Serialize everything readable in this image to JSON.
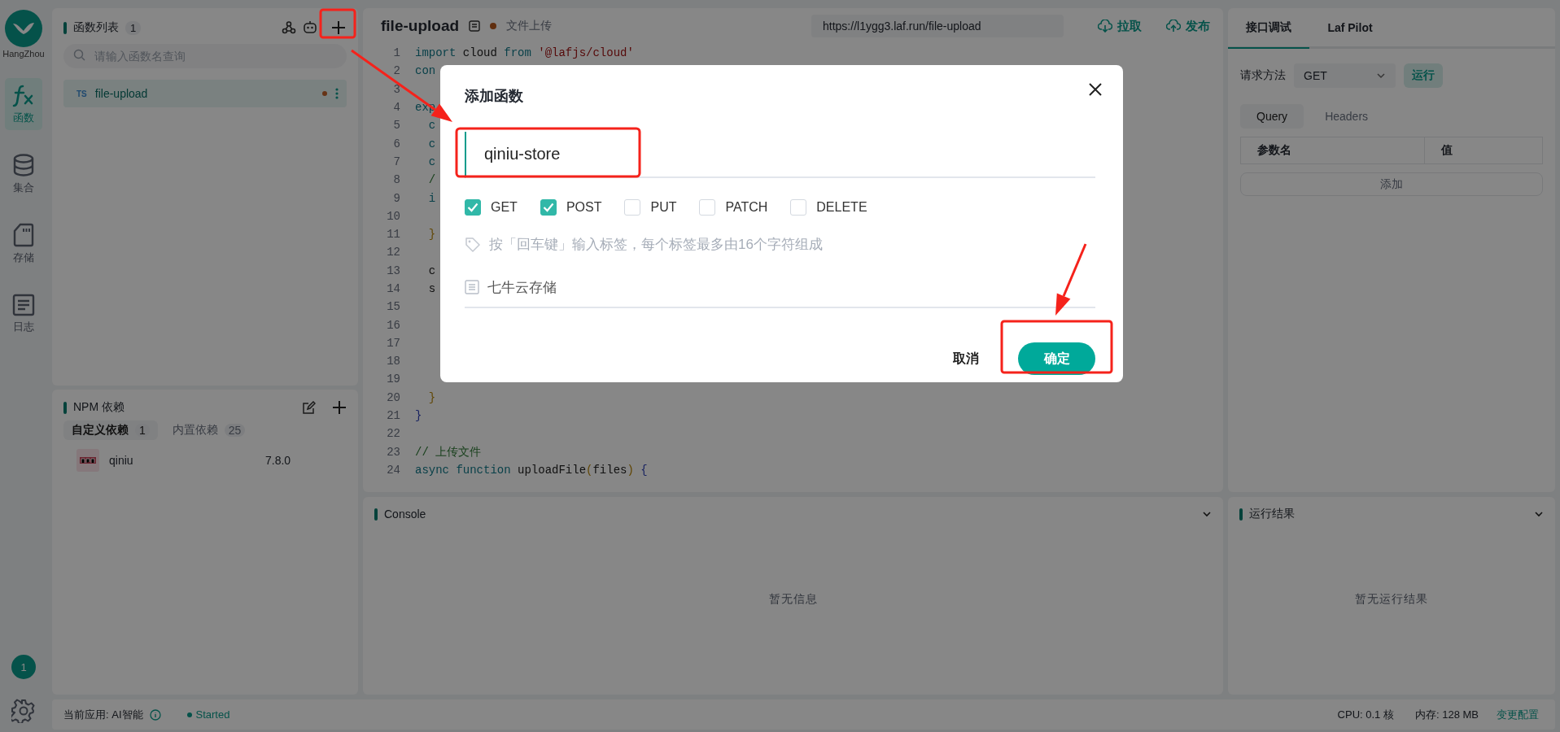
{
  "sidebar": {
    "logo_caption": "HangZhou",
    "items": [
      {
        "label": "函数",
        "selected": true,
        "kind": "function"
      },
      {
        "label": "集合",
        "selected": false,
        "kind": "database"
      },
      {
        "label": "存储",
        "selected": false,
        "kind": "storage"
      },
      {
        "label": "日志",
        "selected": false,
        "kind": "log"
      }
    ],
    "badge": "1"
  },
  "function_list": {
    "title": "函数列表",
    "count": "1",
    "search": {
      "placeholder": "请输入函数名查询"
    },
    "items": [
      {
        "language": "TS",
        "name": "file-upload",
        "selected": true,
        "unsaved": true
      }
    ]
  },
  "npm_panel": {
    "title": "NPM 依赖",
    "tabs": [
      {
        "label": "自定义依赖",
        "count": "1",
        "selected": true
      },
      {
        "label": "内置依赖",
        "count": "25",
        "selected": false
      }
    ],
    "packages": [
      {
        "name": "qiniu",
        "version": "7.8.0"
      }
    ]
  },
  "editor": {
    "title": "file-upload",
    "unsaved": true,
    "description": "文件上传",
    "url": "https://l1ygg3.laf.run/file-upload",
    "actions": [
      {
        "label": "拉取",
        "kind": "pull"
      },
      {
        "label": "发布",
        "kind": "publish"
      }
    ],
    "lines": [
      {
        "number": "1",
        "tokens": [
          {
            "text": "import",
            "kind": "keyword"
          },
          {
            "text": " cloud ",
            "kind": "plain"
          },
          {
            "text": "from",
            "kind": "keyword"
          },
          {
            "text": " '@lafjs/cloud'",
            "kind": "string"
          }
        ]
      },
      {
        "number": "2",
        "tokens": [
          {
            "text": "con",
            "kind": "keyword"
          }
        ]
      },
      {
        "number": "3"
      },
      {
        "number": "4",
        "tokens": [
          {
            "text": "exp",
            "kind": "keyword"
          }
        ]
      },
      {
        "number": "5",
        "tokens": [
          {
            "text": "  c",
            "kind": "keyword"
          }
        ]
      },
      {
        "number": "6",
        "tokens": [
          {
            "text": "  c",
            "kind": "keyword"
          }
        ]
      },
      {
        "number": "7",
        "tokens": [
          {
            "text": "  c",
            "kind": "keyword"
          }
        ]
      },
      {
        "number": "8",
        "tokens": [
          {
            "text": "  /",
            "kind": "comment"
          }
        ]
      },
      {
        "number": "9",
        "tokens": [
          {
            "text": "  i",
            "kind": "keyword"
          }
        ]
      },
      {
        "number": "10"
      },
      {
        "number": "11",
        "tokens": [
          {
            "text": "  }",
            "kind": "bracket"
          }
        ]
      },
      {
        "number": "12"
      },
      {
        "number": "13",
        "tokens": [
          {
            "text": "  c",
            "kind": "plain"
          }
        ]
      },
      {
        "number": "14",
        "tokens": [
          {
            "text": "  s",
            "kind": "plain"
          }
        ]
      },
      {
        "number": "15"
      },
      {
        "number": "16"
      },
      {
        "number": "17"
      },
      {
        "number": "18"
      },
      {
        "number": "19"
      },
      {
        "number": "20",
        "tokens": [
          {
            "text": "  }",
            "kind": "bracket"
          }
        ]
      },
      {
        "number": "21",
        "tokens": [
          {
            "text": "}",
            "kind": "brace"
          }
        ]
      },
      {
        "number": "22"
      },
      {
        "number": "23",
        "tokens": [
          {
            "text": "// 上传文件",
            "kind": "comment"
          }
        ]
      },
      {
        "number": "24",
        "tokens": [
          {
            "text": "async function",
            "kind": "keyword"
          },
          {
            "text": " uploadFile",
            "kind": "plain"
          },
          {
            "text": "(",
            "kind": "bracket"
          },
          {
            "text": "files",
            "kind": "plain"
          },
          {
            "text": ")",
            "kind": "bracket"
          },
          {
            "text": " {",
            "kind": "brace"
          }
        ]
      }
    ]
  },
  "debug_panel": {
    "tabs": [
      {
        "label": "接口调试",
        "selected": true
      },
      {
        "label": "Laf Pilot",
        "selected": false
      }
    ],
    "method_label": "请求方法",
    "method": "GET",
    "run_button": "运行",
    "param_tabs": [
      {
        "label": "Query",
        "selected": true
      },
      {
        "label": "Headers",
        "selected": false
      }
    ],
    "columns": [
      "参数名",
      "值"
    ],
    "add_button": "添加"
  },
  "console": {
    "title": "Console",
    "empty_text": "暂无信息"
  },
  "results": {
    "title": "运行结果",
    "empty_text": "暂无运行结果"
  },
  "status_bar": {
    "app_label": "当前应用: AI智能",
    "status": "Started",
    "cpu": "CPU: 0.1 核",
    "memory": "内存: 128 MB",
    "config_link": "变更配置"
  },
  "dialog": {
    "title": "添加函数",
    "name_value": "qiniu-store",
    "methods": [
      {
        "label": "GET",
        "checked": true
      },
      {
        "label": "POST",
        "checked": true
      },
      {
        "label": "PUT",
        "checked": false
      },
      {
        "label": "PATCH",
        "checked": false
      },
      {
        "label": "DELETE",
        "checked": false
      }
    ],
    "tags_placeholder": "按「回车键」输入标签，每个标签最多由16个字符组成",
    "description_value": "七牛云存储",
    "cancel": "取消",
    "confirm": "确定"
  }
}
